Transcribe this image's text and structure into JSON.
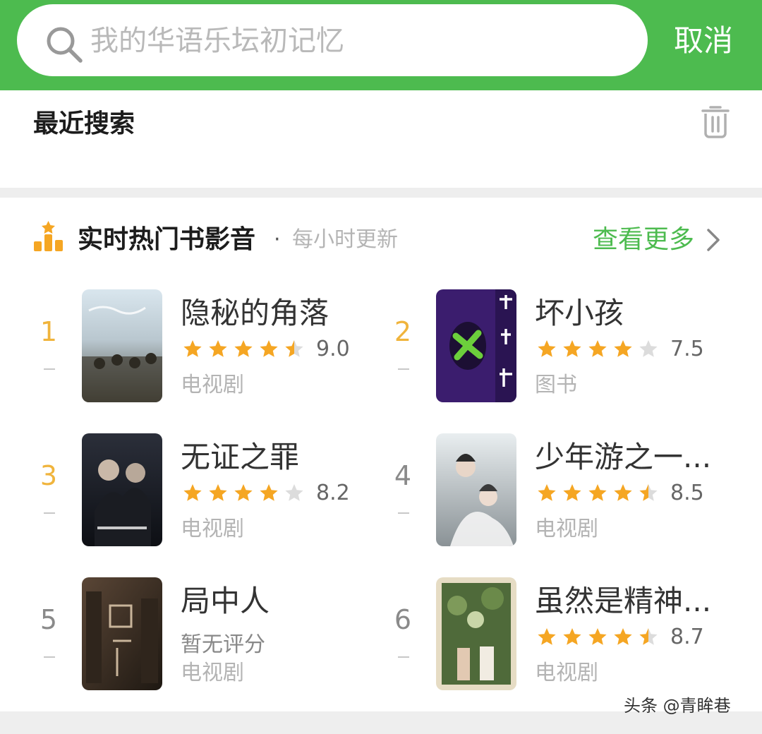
{
  "search": {
    "placeholder": "我的华语乐坛初记忆",
    "cancel_label": "取消"
  },
  "recent": {
    "title": "最近搜索"
  },
  "hot": {
    "title": "实时热门书影音",
    "dot": "·",
    "subtitle": "每小时更新",
    "more_label": "查看更多",
    "items": [
      {
        "rank": "1",
        "title": "隐秘的角落",
        "rating": 4.5,
        "score": "9.0",
        "category": "电视剧",
        "rank_style": "top"
      },
      {
        "rank": "2",
        "title": "坏小孩",
        "rating": 4,
        "score": "7.5",
        "category": "图书",
        "rank_style": "top"
      },
      {
        "rank": "3",
        "title": "无证之罪",
        "rating": 4,
        "score": "8.2",
        "category": "电视剧",
        "rank_style": "top"
      },
      {
        "rank": "4",
        "title": "少年游之一...",
        "rating": 4.5,
        "score": "8.5",
        "category": "电视剧",
        "rank_style": "norm"
      },
      {
        "rank": "5",
        "title": "局中人",
        "rating": null,
        "score": null,
        "no_score_text": "暂无评分",
        "category": "电视剧",
        "rank_style": "norm"
      },
      {
        "rank": "6",
        "title": "虽然是精神...",
        "rating": 4.5,
        "score": "8.7",
        "category": "电视剧",
        "rank_style": "norm"
      }
    ]
  },
  "watermark": "头条 @青眸巷",
  "colors": {
    "brand_green": "#4dbb4f",
    "rank_top": "#f0b43c",
    "star": "#f5a623",
    "star_empty": "#dcdcdc"
  }
}
